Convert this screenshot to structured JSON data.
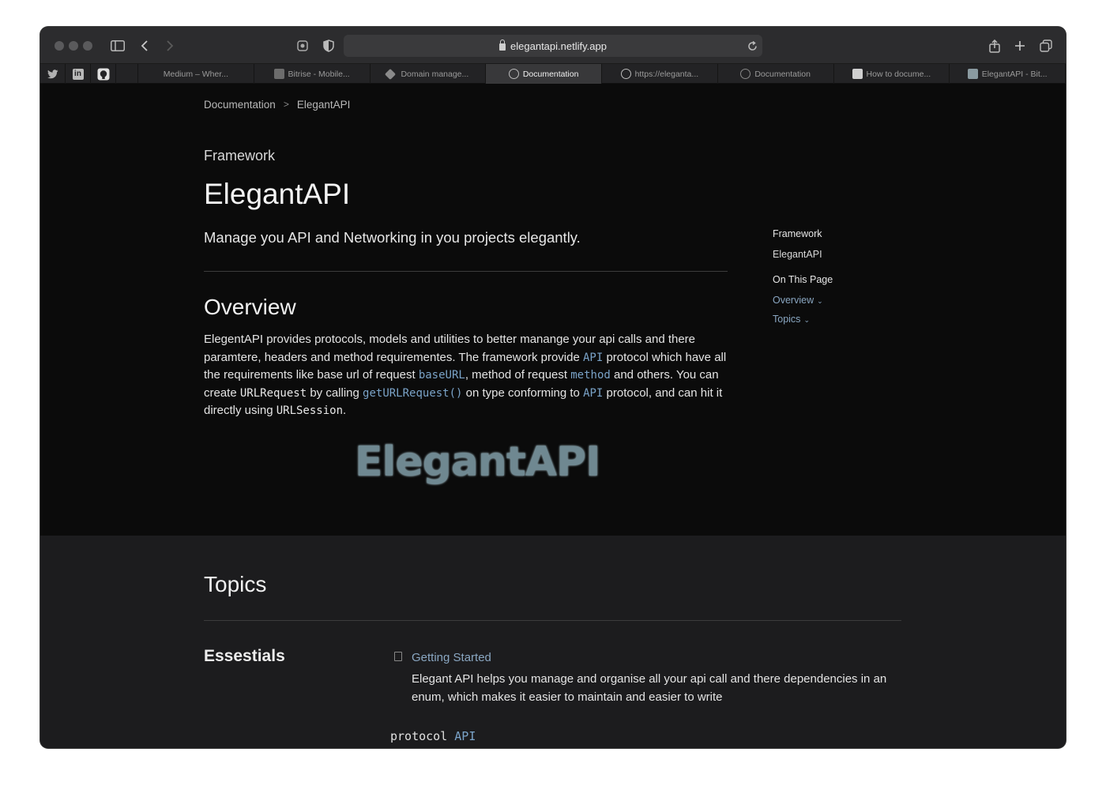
{
  "browser": {
    "url": "elegantapi.netlify.app",
    "pinned_tabs": [
      {
        "icon": "twitter-icon"
      },
      {
        "icon": "linkedin-icon"
      },
      {
        "icon": "github-icon"
      }
    ],
    "tabs": [
      {
        "label": "Medium – Wher...",
        "icon": "medium-icon",
        "active": false
      },
      {
        "label": "Bitrise - Mobile...",
        "icon": "bitrise-icon",
        "active": false
      },
      {
        "label": "Domain manage...",
        "icon": "netlify-icon",
        "active": false
      },
      {
        "label": "Documentation",
        "icon": "globe-icon",
        "active": true
      },
      {
        "label": "https://eleganta...",
        "icon": "globe-icon",
        "active": false
      },
      {
        "label": "Documentation",
        "icon": "compass-icon",
        "active": false
      },
      {
        "label": "How to docume...",
        "icon": "swift-icon",
        "active": false
      },
      {
        "label": "ElegantAPI - Bit...",
        "icon": "bitbucket-icon",
        "active": false
      }
    ]
  },
  "breadcrumb": {
    "items": [
      "Documentation",
      "ElegantAPI"
    ],
    "separator": ">"
  },
  "header": {
    "eyebrow": "Framework",
    "title": "ElegantAPI",
    "abstract": "Manage you API and Networking in you projects elegantly."
  },
  "overview": {
    "heading": "Overview",
    "t1": "ElegentAPI provides protocols, models and utilities to better manange your api calls and there paramtere, headers and method requirementes. The framework provide ",
    "c1": "API",
    "t2": " protocol which have all the requirements like base url of request ",
    "c2": "baseURL",
    "t3": ", method of request ",
    "c3": "method",
    "t4": " and others. You can create ",
    "c4": "URLRequest",
    "t5": " by calling ",
    "c5": "getURLRequest()",
    "t6": " on type conforming to ",
    "c6": "API",
    "t7": " protocol, and can hit it directly using ",
    "c7": "URLSession",
    "t8": "."
  },
  "hero_logo_text": "ElegantAPI",
  "aside": {
    "framework_label": "Framework",
    "framework_name": "ElegantAPI",
    "on_this_page": "On This Page",
    "links": [
      "Overview",
      "Topics"
    ]
  },
  "topics": {
    "heading": "Topics",
    "group": "Essestials",
    "article_title": "Getting Started",
    "article_desc": "Elegant API helps you manage and organise all your api call and there dependencies in an enum, which makes it easier to maintain and easier to write",
    "protocol_keyword": "protocol",
    "protocol_name": "API"
  },
  "colors": {
    "link": "#8aa7c2",
    "code_link": "#7aa3c8",
    "hero": "#6f8891",
    "background": "#0b0b0b",
    "topics_background": "#1c1c1e"
  }
}
